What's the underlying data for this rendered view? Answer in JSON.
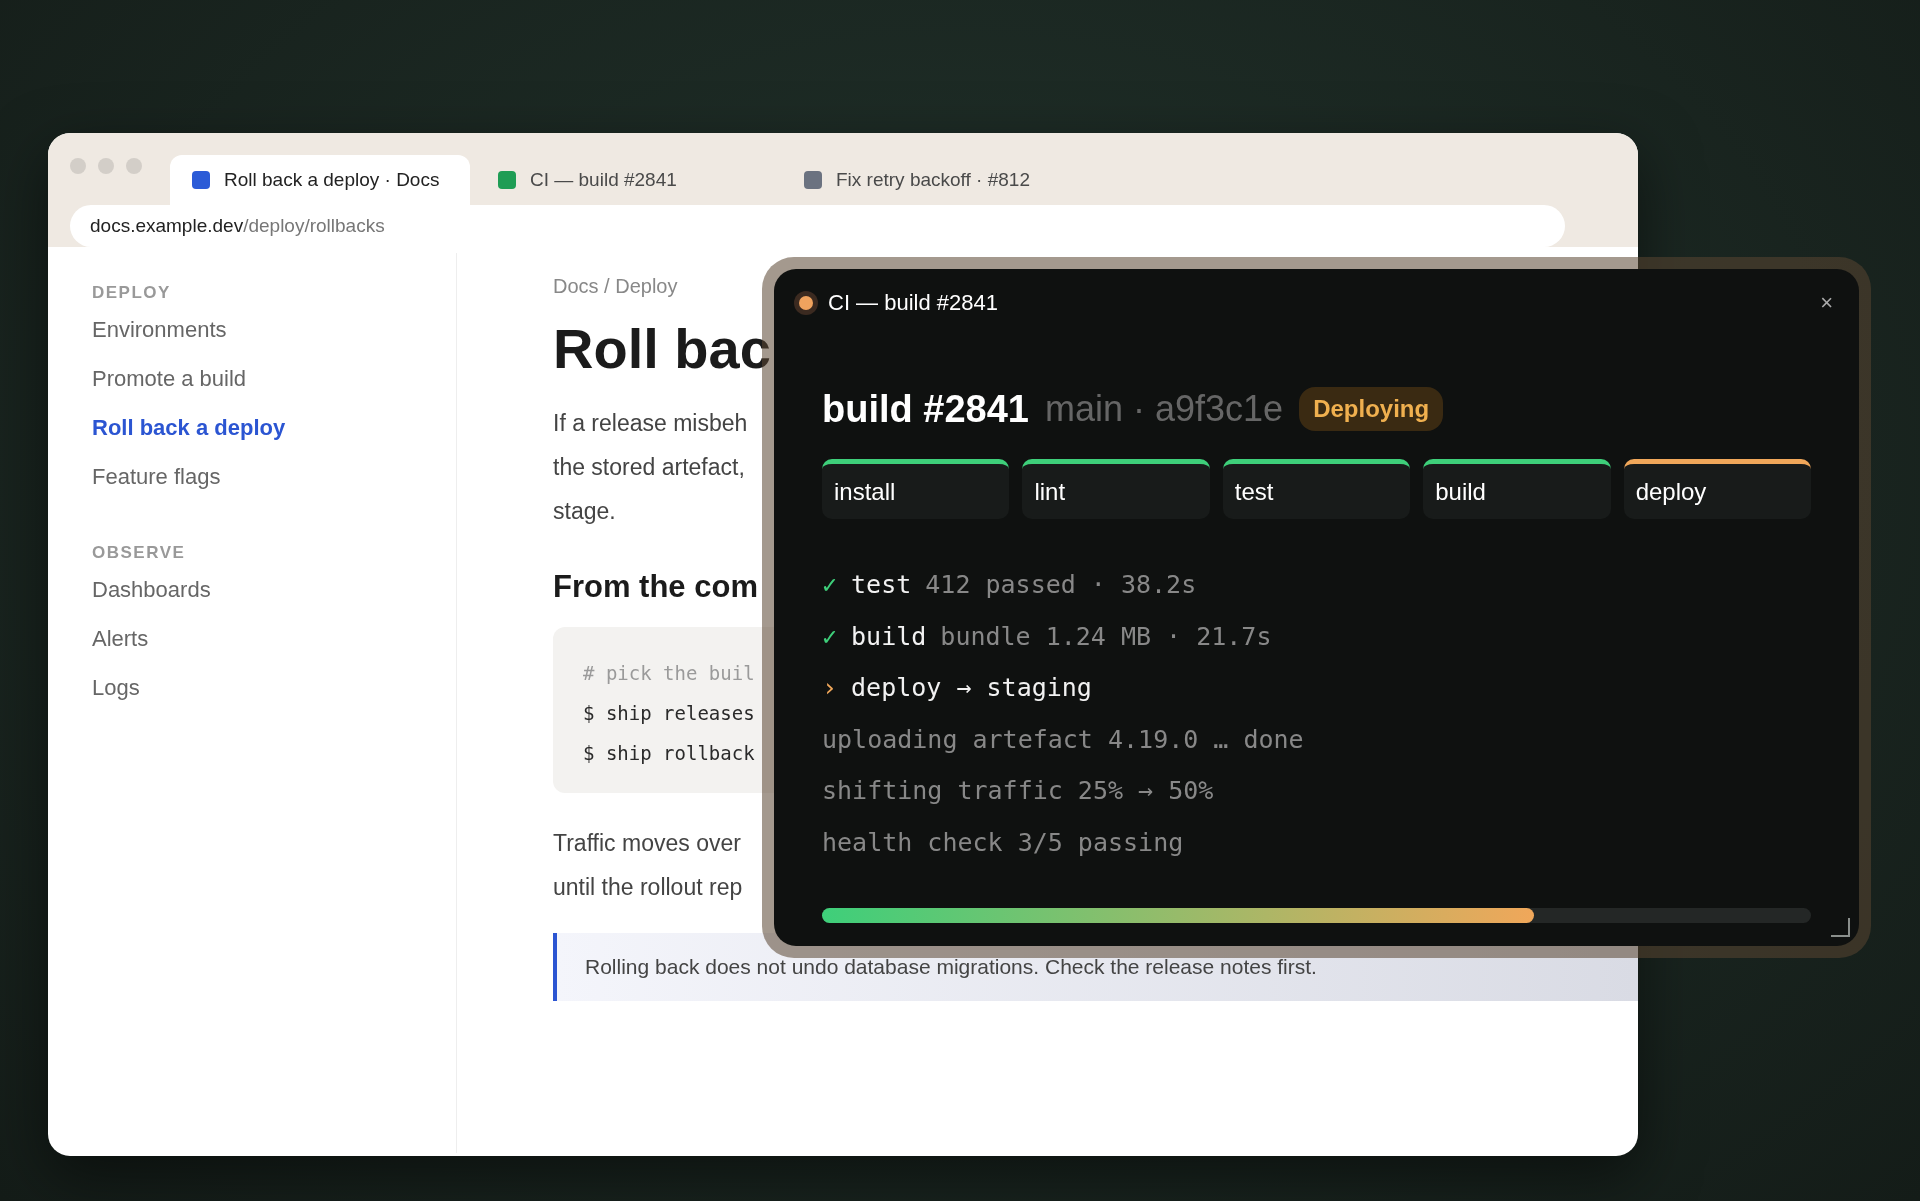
{
  "browser": {
    "tabs": [
      {
        "label": "Roll back a deploy · Docs",
        "color": "#2b5bd7",
        "selected": true
      },
      {
        "label": "CI — build #2841",
        "color": "#1f9d55",
        "selected": false
      },
      {
        "label": "Fix retry backoff · #812",
        "color": "#6b7280",
        "selected": false
      }
    ],
    "address": {
      "host": "docs.example.dev",
      "path": "/deploy/rollbacks"
    }
  },
  "sidebar": {
    "sections": [
      {
        "heading": "DEPLOY",
        "items": [
          {
            "label": "Environments",
            "selected": false
          },
          {
            "label": "Promote a build",
            "selected": false
          },
          {
            "label": "Roll back a deploy",
            "selected": true
          },
          {
            "label": "Feature flags",
            "selected": false
          }
        ]
      },
      {
        "heading": "OBSERVE",
        "items": [
          {
            "label": "Dashboards",
            "selected": false
          },
          {
            "label": "Alerts",
            "selected": false
          },
          {
            "label": "Logs",
            "selected": false
          }
        ]
      }
    ]
  },
  "doc": {
    "breadcrumb": "Docs / Deploy",
    "title": "Roll bac",
    "intro_lines": [
      "If a release misbeh",
      "the stored artefact,",
      "stage."
    ],
    "subheading": "From the com",
    "code_lines": [
      {
        "kind": "comment",
        "text": "# pick the buil"
      },
      {
        "kind": "command",
        "text": "$ ship releases"
      },
      {
        "kind": "command",
        "text": "$ ship rollback"
      }
    ],
    "body_lines": [
      "Traffic moves over",
      "until the rollout rep"
    ],
    "callout": "Rolling back does not undo database migrations. Check the release notes first."
  },
  "ci_panel": {
    "title": "CI — build #2841",
    "close": "×",
    "build": {
      "title": "build #2841",
      "ref": "main · a9f3c1e",
      "badge": "Deploying"
    },
    "stages": [
      {
        "label": "install",
        "done": true
      },
      {
        "label": "lint",
        "done": true
      },
      {
        "label": "test",
        "done": true
      },
      {
        "label": "build",
        "done": true
      },
      {
        "label": "deploy",
        "done": false
      }
    ],
    "log": [
      {
        "kind": "done",
        "marker": "✓",
        "name": "test",
        "detail": "412 passed · 38.2s"
      },
      {
        "kind": "done",
        "marker": "✓",
        "name": "build",
        "detail": "bundle 1.24 MB · 21.7s"
      },
      {
        "kind": "active",
        "marker": "›",
        "name": "deploy → staging"
      },
      {
        "kind": "output",
        "text": "uploading artefact 4.19.0 … done"
      },
      {
        "kind": "output",
        "text": "shifting traffic 25% → 50%"
      },
      {
        "kind": "output",
        "text": "health check 3/5 passing"
      }
    ],
    "progress": {
      "level": 0.72
    }
  }
}
